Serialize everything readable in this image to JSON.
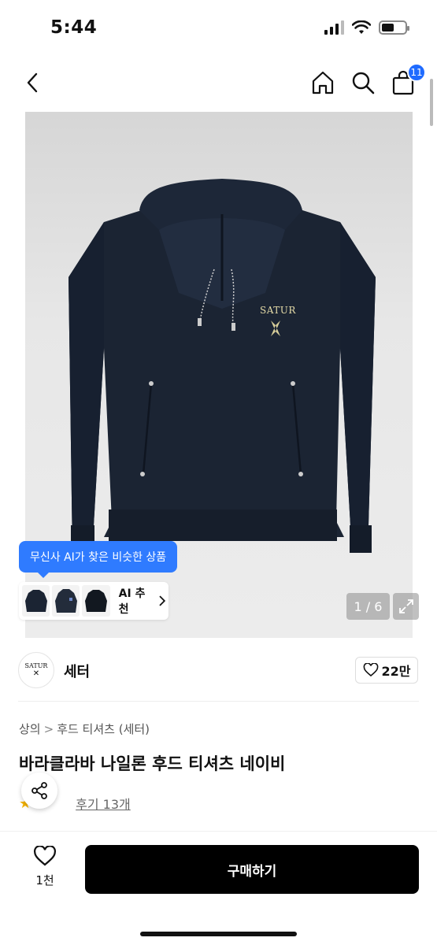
{
  "status_bar": {
    "time": "5:44"
  },
  "nav": {
    "cart_count": "11"
  },
  "hero": {
    "brand_embroidery": "SATUR",
    "page_counter": "1 / 6"
  },
  "ai": {
    "tooltip": "무신사 AI가 찾은 비슷한 상품",
    "recommend_label": "AI 추천"
  },
  "brand": {
    "logo_text": "SATUR",
    "name": "세터",
    "like_count": "22만"
  },
  "breadcrumb": {
    "category": "상의",
    "subcategory": "후드 티셔츠 (세터)",
    "separator": ">"
  },
  "product": {
    "title": "바라클라바 나일론 후드 티셔츠 네이비",
    "review_link": "후기 13개"
  },
  "bottom": {
    "wish_count": "1천",
    "buy_label": "구매하기"
  },
  "colors": {
    "accent": "#2f7bff",
    "badge": "#1f6bff",
    "hoodie": "#1b2433"
  }
}
